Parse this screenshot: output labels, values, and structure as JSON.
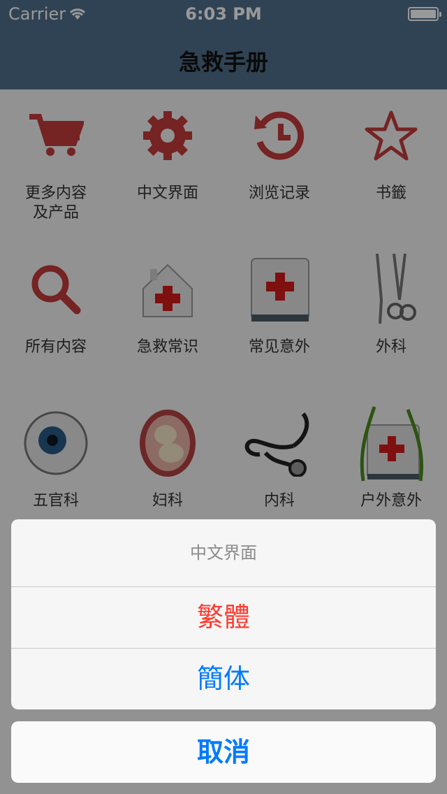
{
  "status": {
    "carrier": "Carrier",
    "time": "6:03 PM"
  },
  "nav": {
    "title": "急救手册"
  },
  "grid": {
    "items": [
      {
        "label": "更多内容\n及产品",
        "icon": "cart-icon"
      },
      {
        "label": "中文界面",
        "icon": "gear-icon"
      },
      {
        "label": "浏览记录",
        "icon": "history-icon"
      },
      {
        "label": "书籤",
        "icon": "star-icon"
      },
      {
        "label": "所有内容",
        "icon": "search-icon"
      },
      {
        "label": "急救常识",
        "icon": "firstaid-house-icon"
      },
      {
        "label": "常见意外",
        "icon": "firstaid-book-icon"
      },
      {
        "label": "外科",
        "icon": "surgical-tools-icon"
      },
      {
        "label": "五官科",
        "icon": "eye-icon"
      },
      {
        "label": "妇科",
        "icon": "fetus-icon"
      },
      {
        "label": "内科",
        "icon": "stethoscope-icon"
      },
      {
        "label": "户外意外",
        "icon": "outdoor-firstaid-icon"
      }
    ]
  },
  "action_sheet": {
    "title": "中文界面",
    "options": [
      "繁體",
      "簡体"
    ],
    "cancel": "取消"
  },
  "colors": {
    "nav": "#51718d",
    "icon_red": "#c33b3b",
    "destructive": "#ff3b30",
    "action": "#007aff"
  }
}
